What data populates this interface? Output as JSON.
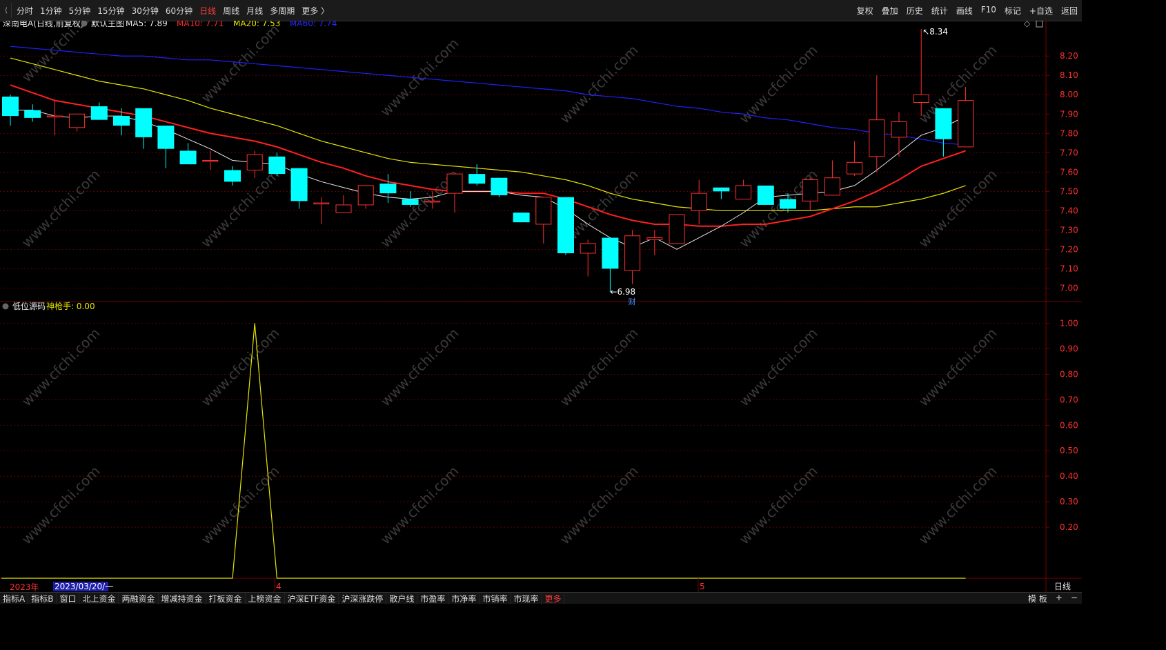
{
  "toolbar": {
    "periods": [
      "分时",
      "1分钟",
      "5分钟",
      "15分钟",
      "30分钟",
      "60分钟",
      "日线",
      "周线",
      "月线",
      "多周期",
      "更多 〉"
    ],
    "active_index": 6,
    "tools": [
      "复权",
      "叠加",
      "历史",
      "统计",
      "画线",
      "F10",
      "标记",
      "+自选",
      "返回"
    ]
  },
  "main_header": {
    "stock": "深南电A(日线,前复权)",
    "template": "默认主图",
    "ma": [
      {
        "label": "MA5: 7.89",
        "color": "#e8e8e8"
      },
      {
        "label": "MA10: 7.71",
        "color": "#ff2a2a"
      },
      {
        "label": "MA20: 7.53",
        "color": "#e6e600"
      },
      {
        "label": "MA60: 7.74",
        "color": "#2a2aff"
      }
    ]
  },
  "sub_header": {
    "name": "低位源码",
    "value": "神枪手: 0.00",
    "value_color": "#e6e600"
  },
  "axis_footer": {
    "year": "2023年",
    "date": "2023/03/20/一",
    "month4": "4",
    "month5": "5",
    "period": "日线"
  },
  "watermark": "www.cfchi.com",
  "bottom_tabs": [
    "指标A",
    "指标B",
    "窗口",
    "北上资金",
    "两融资金",
    "增减持资金",
    "打板资金",
    "上榜资金",
    "沪深ETF资金",
    "沪深涨跌停",
    "散户线",
    "市盈率",
    "市净率",
    "市销率",
    "市现率",
    "更多"
  ],
  "bottom_active": 15,
  "bottom_right": [
    "模 板",
    "+",
    "−"
  ],
  "colors": {
    "up": "#ff3030",
    "down": "#00ffff",
    "ma5": "#e8e8e8",
    "ma10": "#ff2020",
    "ma20": "#e6e600",
    "ma60": "#2020ff",
    "grid": "#7a0000",
    "indicator": "#e6e600"
  },
  "chart_data": [
    {
      "type": "candlestick",
      "title": "深南电A(日线,前复权)",
      "ylim": [
        6.93,
        8.34
      ],
      "yticks": [
        7.0,
        7.1,
        7.2,
        7.3,
        7.4,
        7.5,
        7.6,
        7.7,
        7.8,
        7.9,
        8.0,
        8.1,
        8.2
      ],
      "high_label": "8.34",
      "low_label": "6.98",
      "event_label": "财",
      "candles": [
        {
          "o": 7.99,
          "h": 8.0,
          "l": 7.84,
          "c": 7.89
        },
        {
          "o": 7.92,
          "h": 7.95,
          "l": 7.86,
          "c": 7.88
        },
        {
          "o": 7.89,
          "h": 7.97,
          "l": 7.79,
          "c": 7.89
        },
        {
          "o": 7.83,
          "h": 7.9,
          "l": 7.81,
          "c": 7.9
        },
        {
          "o": 7.94,
          "h": 7.96,
          "l": 7.87,
          "c": 7.87
        },
        {
          "o": 7.89,
          "h": 7.93,
          "l": 7.79,
          "c": 7.84
        },
        {
          "o": 7.93,
          "h": 7.93,
          "l": 7.72,
          "c": 7.78
        },
        {
          "o": 7.84,
          "h": 7.84,
          "l": 7.62,
          "c": 7.72
        },
        {
          "o": 7.71,
          "h": 7.75,
          "l": 7.64,
          "c": 7.64
        },
        {
          "o": 7.66,
          "h": 7.71,
          "l": 7.61,
          "c": 7.66
        },
        {
          "o": 7.61,
          "h": 7.63,
          "l": 7.53,
          "c": 7.55
        },
        {
          "o": 7.61,
          "h": 7.71,
          "l": 7.57,
          "c": 7.69
        },
        {
          "o": 7.68,
          "h": 7.7,
          "l": 7.58,
          "c": 7.59
        },
        {
          "o": 7.62,
          "h": 7.62,
          "l": 7.41,
          "c": 7.45
        },
        {
          "o": 7.44,
          "h": 7.47,
          "l": 7.33,
          "c": 7.44
        },
        {
          "o": 7.39,
          "h": 7.48,
          "l": 7.39,
          "c": 7.43
        },
        {
          "o": 7.43,
          "h": 7.53,
          "l": 7.41,
          "c": 7.53
        },
        {
          "o": 7.54,
          "h": 7.59,
          "l": 7.44,
          "c": 7.49
        },
        {
          "o": 7.46,
          "h": 7.5,
          "l": 7.42,
          "c": 7.43
        },
        {
          "o": 7.45,
          "h": 7.5,
          "l": 7.41,
          "c": 7.45
        },
        {
          "o": 7.49,
          "h": 7.59,
          "l": 7.39,
          "c": 7.59
        },
        {
          "o": 7.59,
          "h": 7.64,
          "l": 7.53,
          "c": 7.54
        },
        {
          "o": 7.57,
          "h": 7.57,
          "l": 7.47,
          "c": 7.48
        },
        {
          "o": 7.39,
          "h": 7.39,
          "l": 7.34,
          "c": 7.34
        },
        {
          "o": 7.33,
          "h": 7.47,
          "l": 7.23,
          "c": 7.47
        },
        {
          "o": 7.47,
          "h": 7.47,
          "l": 7.17,
          "c": 7.18
        },
        {
          "o": 7.18,
          "h": 7.25,
          "l": 7.06,
          "c": 7.23
        },
        {
          "o": 7.26,
          "h": 7.26,
          "l": 6.98,
          "c": 7.1
        },
        {
          "o": 7.09,
          "h": 7.3,
          "l": 7.02,
          "c": 7.27
        },
        {
          "o": 7.25,
          "h": 7.3,
          "l": 7.17,
          "c": 7.26
        },
        {
          "o": 7.23,
          "h": 7.38,
          "l": 7.23,
          "c": 7.38
        },
        {
          "o": 7.4,
          "h": 7.56,
          "l": 7.33,
          "c": 7.49
        },
        {
          "o": 7.52,
          "h": 7.52,
          "l": 7.46,
          "c": 7.5
        },
        {
          "o": 7.46,
          "h": 7.56,
          "l": 7.46,
          "c": 7.53
        },
        {
          "o": 7.53,
          "h": 7.53,
          "l": 7.43,
          "c": 7.43
        },
        {
          "o": 7.46,
          "h": 7.49,
          "l": 7.39,
          "c": 7.41
        },
        {
          "o": 7.45,
          "h": 7.57,
          "l": 7.4,
          "c": 7.56
        },
        {
          "o": 7.48,
          "h": 7.66,
          "l": 7.48,
          "c": 7.57
        },
        {
          "o": 7.59,
          "h": 7.76,
          "l": 7.58,
          "c": 7.65
        },
        {
          "o": 7.68,
          "h": 8.1,
          "l": 7.6,
          "c": 7.87
        },
        {
          "o": 7.78,
          "h": 7.91,
          "l": 7.68,
          "c": 7.86
        },
        {
          "o": 7.96,
          "h": 8.34,
          "l": 7.89,
          "c": 8.0
        },
        {
          "o": 7.93,
          "h": 7.93,
          "l": 7.68,
          "c": 7.77
        },
        {
          "o": 7.73,
          "h": 8.04,
          "l": 7.73,
          "c": 7.97
        }
      ],
      "ma5": [
        7.92,
        7.92,
        7.89,
        7.88,
        7.89,
        7.89,
        7.86,
        7.82,
        7.77,
        7.72,
        7.66,
        7.65,
        7.64,
        7.59,
        7.55,
        7.52,
        7.49,
        7.47,
        7.46,
        7.47,
        7.5,
        7.5,
        7.5,
        7.48,
        7.47,
        7.41,
        7.33,
        7.26,
        7.21,
        7.26,
        7.2,
        7.26,
        7.32,
        7.39,
        7.47,
        7.48,
        7.49,
        7.5,
        7.53,
        7.61,
        7.7,
        7.79,
        7.83,
        7.89
      ],
      "ma10": [
        8.05,
        8.01,
        7.97,
        7.95,
        7.93,
        7.91,
        7.89,
        7.86,
        7.83,
        7.8,
        7.78,
        7.76,
        7.73,
        7.69,
        7.65,
        7.62,
        7.58,
        7.55,
        7.53,
        7.51,
        7.5,
        7.5,
        7.5,
        7.49,
        7.49,
        7.46,
        7.42,
        7.38,
        7.35,
        7.33,
        7.33,
        7.32,
        7.32,
        7.33,
        7.33,
        7.35,
        7.37,
        7.41,
        7.45,
        7.5,
        7.56,
        7.63,
        7.67,
        7.71
      ],
      "ma20": [
        8.19,
        8.16,
        8.13,
        8.1,
        8.07,
        8.05,
        8.03,
        8.0,
        7.97,
        7.93,
        7.9,
        7.87,
        7.84,
        7.8,
        7.76,
        7.73,
        7.7,
        7.67,
        7.65,
        7.64,
        7.63,
        7.62,
        7.61,
        7.6,
        7.58,
        7.56,
        7.53,
        7.49,
        7.46,
        7.44,
        7.42,
        7.41,
        7.4,
        7.4,
        7.4,
        7.4,
        7.4,
        7.41,
        7.42,
        7.42,
        7.44,
        7.46,
        7.49,
        7.53
      ],
      "ma60": [
        8.25,
        8.24,
        8.23,
        8.22,
        8.21,
        8.2,
        8.2,
        8.19,
        8.18,
        8.18,
        8.17,
        8.16,
        8.15,
        8.14,
        8.13,
        8.12,
        8.11,
        8.1,
        8.09,
        8.08,
        8.07,
        8.06,
        8.05,
        8.04,
        8.03,
        8.02,
        8.0,
        7.99,
        7.98,
        7.96,
        7.94,
        7.93,
        7.91,
        7.9,
        7.88,
        7.87,
        7.85,
        7.83,
        7.82,
        7.8,
        7.79,
        7.77,
        7.75,
        7.74
      ]
    },
    {
      "type": "line",
      "title": "低位源码",
      "series": [
        {
          "name": "神枪手",
          "values": [
            0,
            0,
            0,
            0,
            0,
            0,
            0,
            0,
            0,
            0,
            0,
            1,
            0,
            0,
            0,
            0,
            0,
            0,
            0,
            0,
            0,
            0,
            0,
            0,
            0,
            0,
            0,
            0,
            0,
            0,
            0,
            0,
            0,
            0,
            0,
            0,
            0,
            0,
            0,
            0,
            0,
            0,
            0,
            0
          ]
        }
      ],
      "ylim": [
        0,
        1.05
      ],
      "yticks": [
        0.2,
        0.3,
        0.4,
        0.5,
        0.6,
        0.7,
        0.8,
        0.9,
        1.0
      ]
    }
  ]
}
